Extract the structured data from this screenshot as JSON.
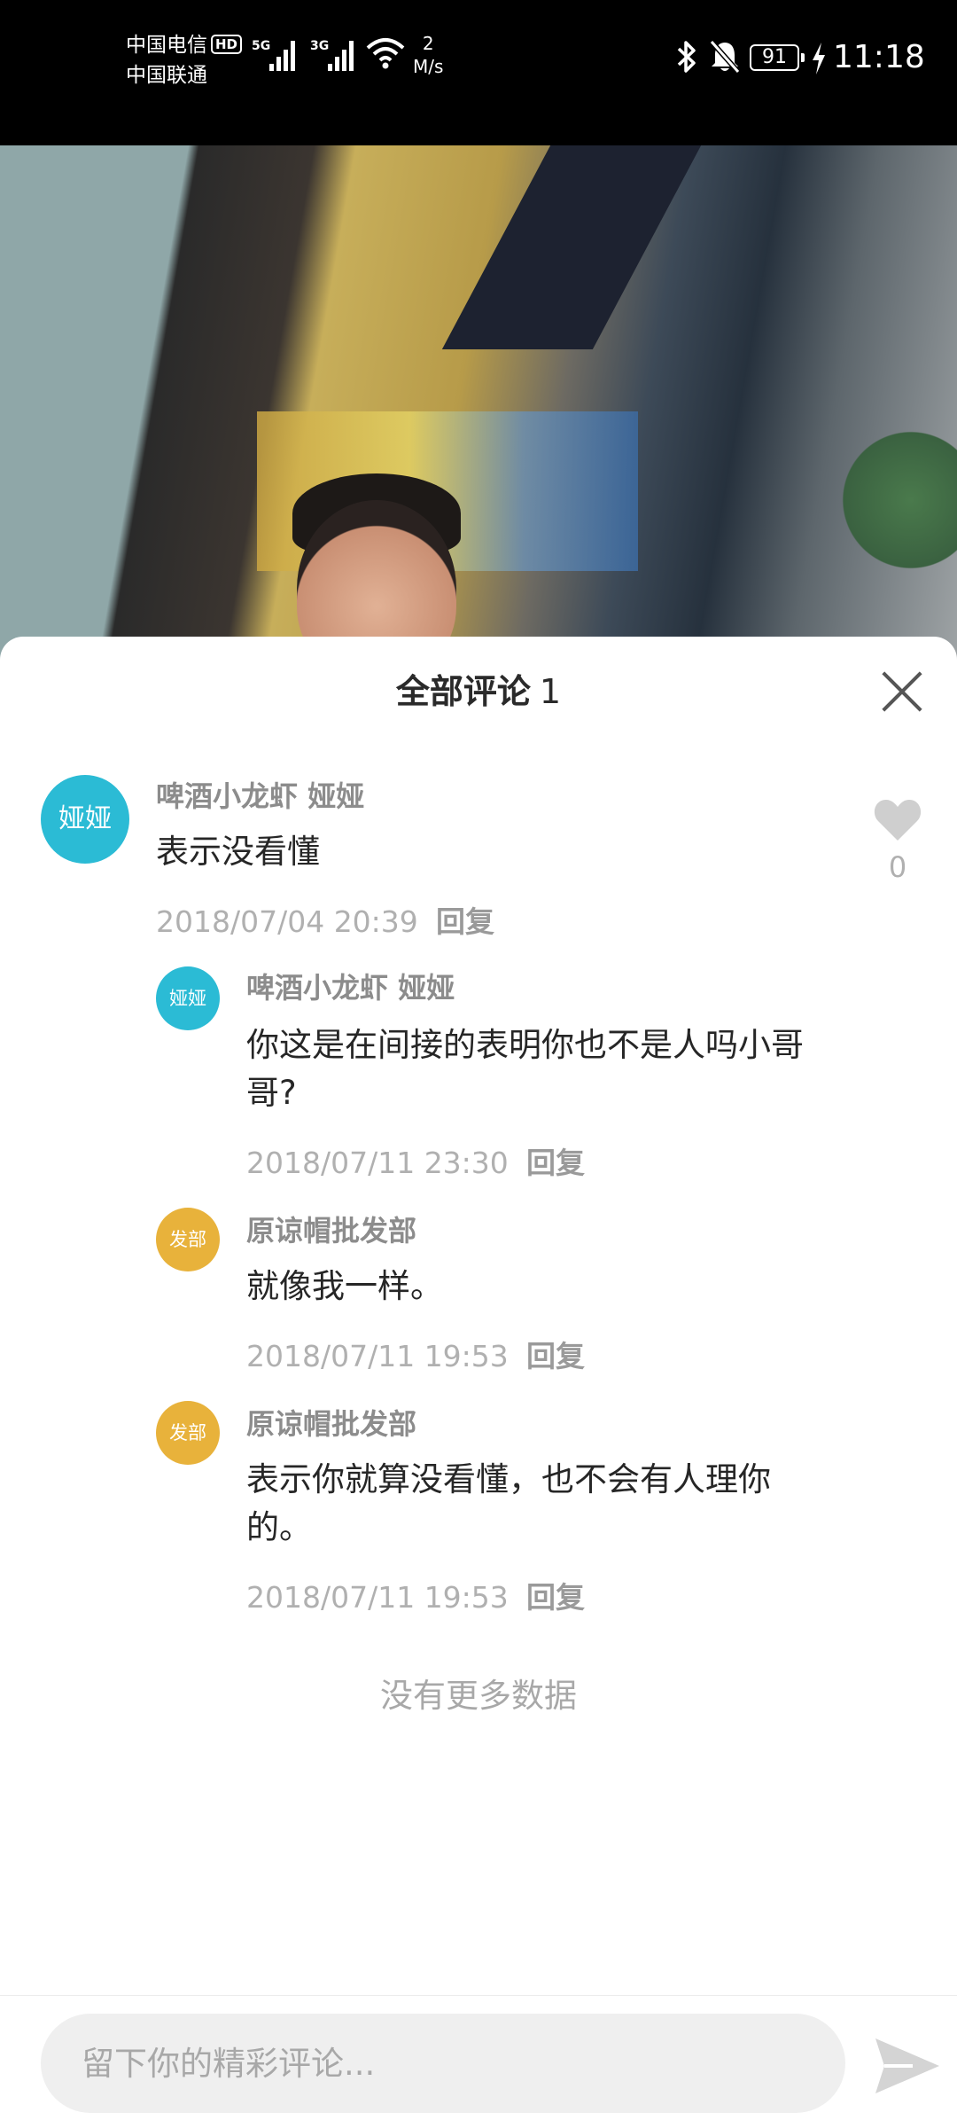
{
  "status_bar": {
    "carrier_1": "中国电信",
    "carrier_1_badge": "HD",
    "carrier_2": "中国联通",
    "net_1": "5G",
    "net_2": "3G",
    "speed_value": "2",
    "speed_unit": "M/s",
    "battery": "91",
    "time": "11:18"
  },
  "comments": {
    "title": "全部评论",
    "count": "1",
    "main": {
      "avatar_text": "娅娅",
      "author": "啤酒小龙虾 娅娅",
      "text": "表示没看懂",
      "time": "2018/07/04 20:39",
      "reply_label": "回复",
      "like_count": "0"
    },
    "replies": [
      {
        "avatar_text": "娅娅",
        "author": "啤酒小龙虾 娅娅",
        "text": "你这是在间接的表明你也不是人吗小哥哥?",
        "time": "2018/07/11 23:30",
        "reply_label": "回复"
      },
      {
        "avatar_text": "发部",
        "author": "原谅帽批发部",
        "text": "就像我一样。",
        "time": "2018/07/11 19:53",
        "reply_label": "回复"
      },
      {
        "avatar_text": "发部",
        "author": "原谅帽批发部",
        "text": "表示你就算没看懂，也不会有人理你的。",
        "time": "2018/07/11 19:53",
        "reply_label": "回复"
      }
    ],
    "no_more": "没有更多数据"
  },
  "input": {
    "placeholder": "留下你的精彩评论..."
  },
  "colors": {
    "avatar_cyan": "#2bbbd5",
    "avatar_yellow": "#e8b23b"
  }
}
